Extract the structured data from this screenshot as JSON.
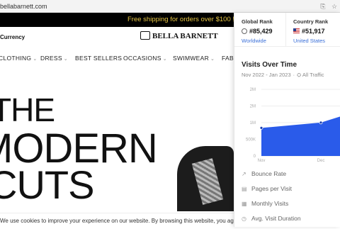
{
  "browser": {
    "url": "bellabarnett.com"
  },
  "promo": {
    "text": "Free shipping for orders over $100 !"
  },
  "header": {
    "currency": "Currency",
    "logo": "BELLA BARNETT"
  },
  "nav": {
    "items": [
      "CLOTHING",
      "DRESS",
      "BEST SELLERS",
      "OCCASIONS",
      "SWIMWEAR",
      "FAB"
    ]
  },
  "hero": {
    "line1": "THE",
    "line2": "MODERN",
    "line3": "CUTS"
  },
  "cookie": {
    "text": "We use cookies to improve your experience on our website. By browsing this website, you agree to our use of cookies."
  },
  "panel": {
    "global_rank": {
      "label": "Global Rank",
      "value": "#85,429",
      "scope": "Worldwide"
    },
    "country_rank": {
      "label": "Country Rank",
      "value": "#51,917",
      "scope": "United States"
    },
    "visits_title": "Visits Over Time",
    "visits_range": "Nov 2022 - Jan 2023",
    "visits_filter": "All Traffic",
    "metrics": [
      "Bounce Rate",
      "Pages per Visit",
      "Monthly Visits",
      "Avg. Visit Duration"
    ]
  },
  "chart_data": {
    "type": "area",
    "categories": [
      "Nov",
      "Dec",
      "Jan"
    ],
    "x_tick_labels": [
      "Nov",
      "Dec"
    ],
    "values": [
      1000000,
      1200000,
      1600000
    ],
    "y_ticks": [
      "0",
      "500K",
      "1M",
      "2M",
      "2M"
    ],
    "ylim": [
      0,
      2500000
    ],
    "color": "#2a5bea",
    "grid": true
  }
}
